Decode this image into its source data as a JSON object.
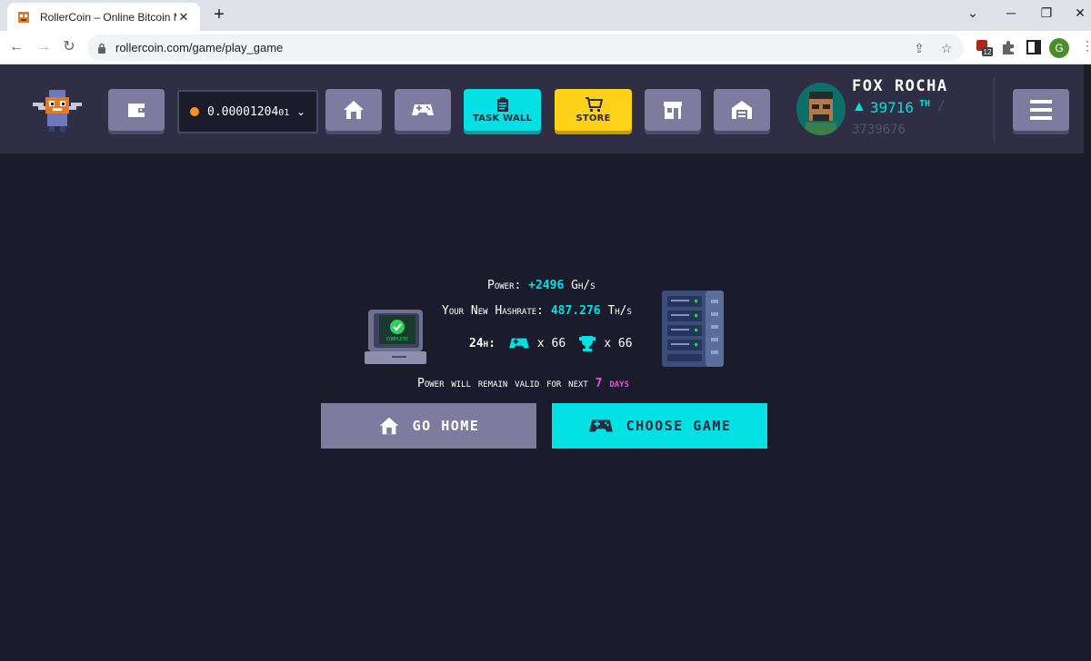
{
  "browser": {
    "tab_title": "RollerCoin – Online Bitcoin Minin",
    "url": "rollercoin.com/game/play_game",
    "extension_badge": "12",
    "profile_initial": "G"
  },
  "header": {
    "balance_main": "0.00001204",
    "balance_tail": "01",
    "task_wall_label": "TASK WALL",
    "store_label": "STORE",
    "user_name": "FOX ROCHA",
    "user_power": "39716",
    "user_power_unit": "TH",
    "user_power_slash": "/",
    "user_power_total": "3739676"
  },
  "result": {
    "power_label": "Power:",
    "power_value": "+2496",
    "power_unit": "Gh/s",
    "hashrate_label": "Your New Hashrate:",
    "hashrate_value": "487.276",
    "hashrate_unit": "Th/s",
    "period_label": "24h:",
    "games_count": "x 66",
    "wins_count": "x 66",
    "complete_label": "COMPLETE",
    "validity_text": "Power will remain valid for next",
    "validity_days": "7 days"
  },
  "buttons": {
    "go_home": "GO HOME",
    "choose_game": "CHOOSE GAME"
  },
  "colors": {
    "accent_cyan": "#03e1e4",
    "accent_yellow": "#ffd21a",
    "accent_pink": "#e84fd1",
    "button_purple": "#7f7b9e",
    "header_bg": "#2f2e45",
    "page_bg": "#1c1b2c"
  }
}
